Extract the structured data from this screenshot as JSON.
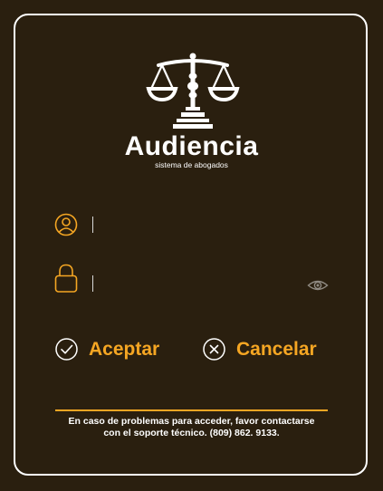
{
  "app": {
    "title": "Audiencia",
    "subtitle": "sistema de abogados"
  },
  "login": {
    "username": {
      "value": "",
      "placeholder": "",
      "icon": "user-icon"
    },
    "password": {
      "value": "",
      "placeholder": "",
      "icon": "lock-icon",
      "toggle_icon": "eye-icon"
    }
  },
  "actions": {
    "accept_label": "Aceptar",
    "accept_icon": "check-circle-icon",
    "cancel_label": "Cancelar",
    "cancel_icon": "x-circle-icon"
  },
  "footer": {
    "help_line1": "En caso de problemas para acceder, favor contactarse",
    "help_line2": "con el soporte técnico. (809) 862. 9133."
  },
  "colors": {
    "background": "#2a1f0f",
    "accent": "#f5a623",
    "text": "#ffffff",
    "border": "#ffffff"
  }
}
